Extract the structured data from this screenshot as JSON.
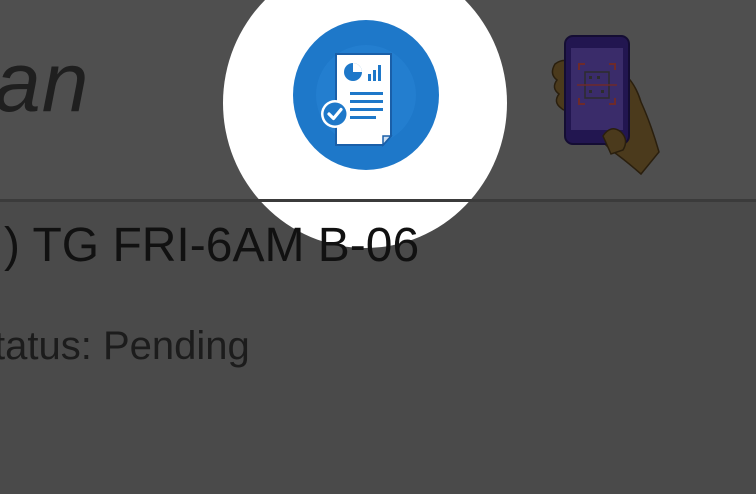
{
  "app_bar": {
    "title_fragment": "an",
    "report_button_icon": "report-check-icon",
    "scan_button_icon": "phone-scan-icon"
  },
  "list": {
    "items": [
      {
        "title": ") TG FRI-6AM B-06",
        "status": "tatus: Pending"
      }
    ]
  },
  "colors": {
    "overlay": "#4a4a4a",
    "spotlight": "#ffffff",
    "report_button": "#1e78c9"
  }
}
